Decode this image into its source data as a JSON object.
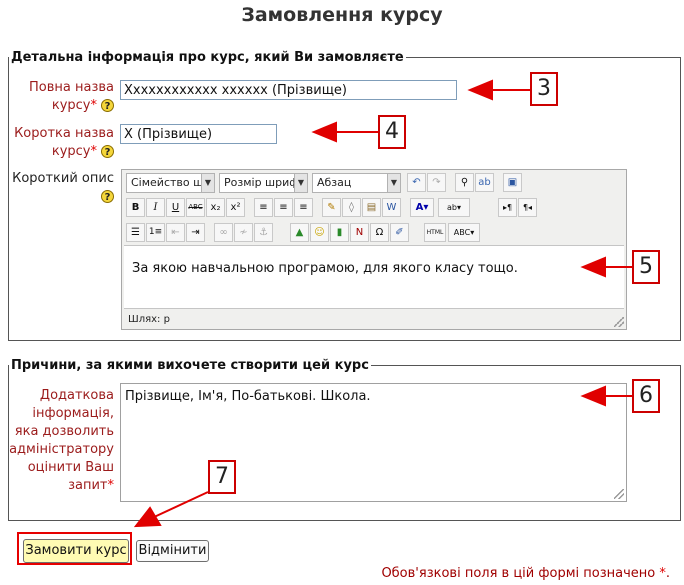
{
  "page": {
    "title": "Замовлення курсу"
  },
  "section1": {
    "legend": "Детальна інформація про курс, який Ви замовляєте",
    "full_name": {
      "label_line1": "Повна назва",
      "label_line2": "курсу",
      "required_mark": "*",
      "value": "Хxxxxxxxxxxx xxxxxx (Прізвище)"
    },
    "short_name": {
      "label_line1": "Коротка назва",
      "label_line2": "курсу",
      "required_mark": "*",
      "value": "Х (Прізвище)"
    },
    "summary": {
      "label": "Короткий опис",
      "toolbar": {
        "font_family": "Сімейство шри",
        "font_size": "Розмір шрифта",
        "format": "Абзац"
      },
      "content": "За якою навчальною програмою, для якого класу тощо.",
      "path": "Шлях: p"
    }
  },
  "section2": {
    "legend": "Причини, за якими вихочете створити цей курс",
    "reason": {
      "label_lines": [
        "Додаткова",
        "інформація,",
        "яка дозволить",
        "адміністратору",
        "оцінити Ваш",
        "запит"
      ],
      "required_mark": "*",
      "value": "Прізвище, Ім'я, По-батькові. Школа."
    }
  },
  "buttons": {
    "submit": "Замовити курс",
    "cancel": "Відмінити"
  },
  "footer": {
    "required_note": "Обов'язкові поля в цій формі позначено",
    "required_mark": "*",
    "period": "."
  },
  "callouts": [
    "3",
    "4",
    "5",
    "6",
    "7"
  ],
  "colors": {
    "callout_red": "#e00000",
    "required_red": "#e00000",
    "label_red": "#9b1b1b",
    "submit_yellow": "#fffbb3"
  },
  "icons": {
    "help": "help-icon",
    "row2": [
      "bold-icon",
      "italic-icon",
      "underline-icon",
      "strikethrough-icon",
      "subscript-icon",
      "superscript-icon",
      "align-left-icon",
      "align-center-icon",
      "align-right-icon",
      "clean-icon",
      "eraser-icon",
      "paste-text-icon",
      "paste-word-icon",
      "text-color-icon",
      "highlight-icon",
      "ltr-icon",
      "rtl-icon"
    ],
    "row3": [
      "bullet-list-icon",
      "numbered-list-icon",
      "outdent-icon",
      "indent-icon",
      "link-icon",
      "unlink-icon",
      "anchor-icon",
      "image-icon",
      "emoticon-icon",
      "media-icon",
      "nonbreaking-icon",
      "char-map-icon",
      "edit-icon",
      "html-icon",
      "spellcheck-icon"
    ]
  }
}
